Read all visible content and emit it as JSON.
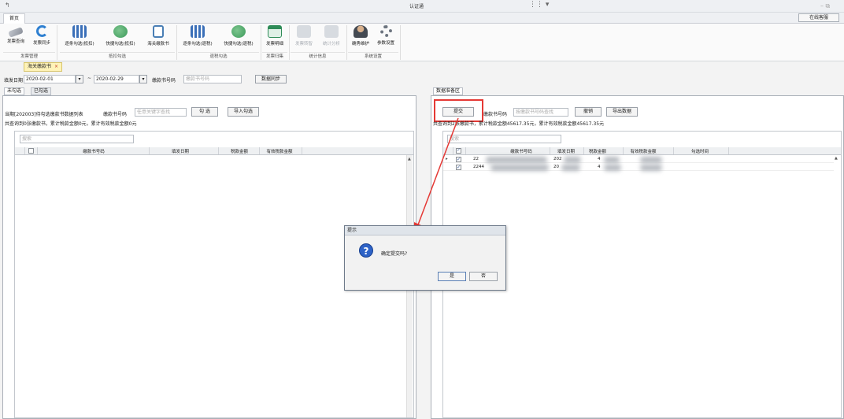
{
  "window": {
    "title": "认证通",
    "icon_glyph": "↰",
    "controls": "– ⧉"
  },
  "center_dock": {
    "glyphs": "⋮⋮ ▾"
  },
  "top_tabs": {
    "home": "首页",
    "online_service": "在线客服"
  },
  "ribbon": {
    "buttons": [
      {
        "label": "发票查询",
        "icon": "pen-icon",
        "color": "#8a8f99"
      },
      {
        "label": "发票同步",
        "icon": "refresh-icon",
        "color": "#2f80d1"
      },
      {
        "label": "逐条勾选(抵扣)",
        "icon": "qr-icon",
        "color": "#3a6fb8"
      },
      {
        "label": "快捷勾选(抵扣)",
        "icon": "globe-icon",
        "color": "#3c9a5a"
      },
      {
        "label": "海关缴款书",
        "icon": "document-icon",
        "color": "#4a7fb5"
      },
      {
        "label": "逐条勾选(退税)",
        "icon": "qr-icon",
        "color": "#3a6fb8"
      },
      {
        "label": "快捷勾选(退税)",
        "icon": "globe-icon",
        "color": "#3c9a5a"
      },
      {
        "label": "发票明细",
        "icon": "spreadsheet-icon",
        "color": "#2e8b57"
      },
      {
        "label": "发票转智",
        "icon": "grid-icon",
        "color": "#b9bfc6"
      },
      {
        "label": "统计分析",
        "icon": "chart-icon",
        "color": "#b9bfc6"
      },
      {
        "label": "确秀维护",
        "icon": "user-icon",
        "color": "#444a52"
      },
      {
        "label": "参数设置",
        "icon": "gear-icon",
        "color": "#6d7580"
      }
    ],
    "groups": [
      "发票管理",
      "抵扣勾选",
      "退税勾选",
      "发票归集",
      "统计信息",
      "系统设置"
    ]
  },
  "doc_tab": {
    "label": "海关缴款书",
    "close": "×"
  },
  "filter": {
    "fill_date_label": "填发日期",
    "date_from": "2020-02-01",
    "tilde": "~",
    "date_to": "2020-02-29",
    "number_label": "缴款书号码",
    "number_placeholder": "缴款书号码",
    "sync_button": "数据同步",
    "dropdown_glyph": "▾"
  },
  "left_panel": {
    "tabs": [
      "未勾选",
      "已勾选"
    ],
    "title": "当期[202003]待勾选缴款书数据列表",
    "number_label": "缴款书号码",
    "keyword_placeholder": "任意关键字查找",
    "select_button": "勾  选",
    "import_button": "导入勾选",
    "summary": "共查询到0张缴款书，累计税款金额0元，累计有效税款金额0元",
    "search_placeholder": "搜索",
    "columns": [
      "缴款书号码",
      "填发日期",
      "税款金额",
      "有效税款金额"
    ],
    "scroll_glyph": "▲"
  },
  "right_panel": {
    "tab": "数据准备区",
    "submit_button": "提交",
    "number_label": "缴款书号码",
    "number_placeholder": "按缴款书号码查找",
    "revoke_button": "撤销",
    "export_button": "导出数据",
    "summary": "共查询到2张缴款书，累计税款金额45617.35元，累计有效税款金额45617.35元",
    "search_placeholder": "搜索",
    "columns": [
      "缴款书号码",
      "填发日期",
      "税款金额",
      "有效税款金额",
      "勾选时间"
    ],
    "rows": [
      {
        "number": "22",
        "date": "202",
        "amount": "4"
      },
      {
        "number": "2244",
        "date": "20",
        "amount": "4"
      }
    ],
    "check_glyph": "✓",
    "row_pointer": "▸",
    "scroll_glyph": "▲"
  },
  "dialog": {
    "title": "提示",
    "icon_glyph": "?",
    "message": "确定提交吗?",
    "yes": "是",
    "no": "否"
  },
  "accent_red": "#e53935"
}
